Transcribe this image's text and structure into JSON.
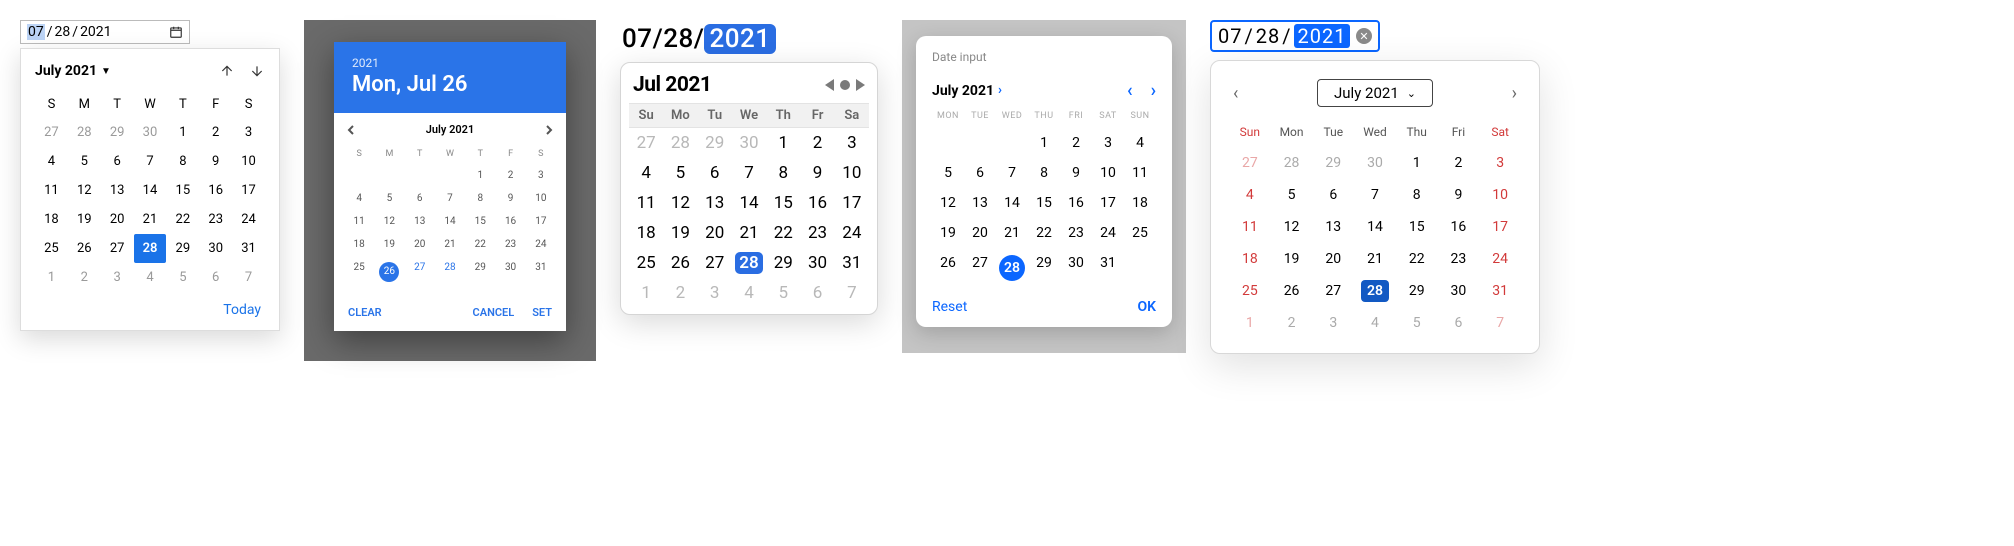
{
  "picker1": {
    "input": {
      "month": "07",
      "day": "28",
      "year": "2021",
      "sep": "/"
    },
    "title": "July 2021",
    "today_label": "Today",
    "dow": [
      "S",
      "M",
      "T",
      "W",
      "T",
      "F",
      "S"
    ],
    "days": [
      {
        "n": 27,
        "muted": true
      },
      {
        "n": 28,
        "muted": true
      },
      {
        "n": 29,
        "muted": true
      },
      {
        "n": 30,
        "muted": true
      },
      {
        "n": 1
      },
      {
        "n": 2
      },
      {
        "n": 3
      },
      {
        "n": 4
      },
      {
        "n": 5
      },
      {
        "n": 6
      },
      {
        "n": 7
      },
      {
        "n": 8
      },
      {
        "n": 9
      },
      {
        "n": 10
      },
      {
        "n": 11
      },
      {
        "n": 12
      },
      {
        "n": 13
      },
      {
        "n": 14
      },
      {
        "n": 15
      },
      {
        "n": 16
      },
      {
        "n": 17
      },
      {
        "n": 18
      },
      {
        "n": 19
      },
      {
        "n": 20
      },
      {
        "n": 21
      },
      {
        "n": 22
      },
      {
        "n": 23
      },
      {
        "n": 24
      },
      {
        "n": 25
      },
      {
        "n": 26
      },
      {
        "n": 27
      },
      {
        "n": 28,
        "sel": true
      },
      {
        "n": 29
      },
      {
        "n": 30
      },
      {
        "n": 31
      },
      {
        "n": 1,
        "muted": true
      },
      {
        "n": 2,
        "muted": true
      },
      {
        "n": 3,
        "muted": true
      },
      {
        "n": 4,
        "muted": true
      },
      {
        "n": 5,
        "muted": true
      },
      {
        "n": 6,
        "muted": true
      },
      {
        "n": 7,
        "muted": true
      }
    ]
  },
  "picker2": {
    "header_year": "2021",
    "header_date": "Mon, Jul 26",
    "nav_title": "July 2021",
    "actions": {
      "clear": "CLEAR",
      "cancel": "CANCEL",
      "set": "SET"
    },
    "dow": [
      "S",
      "M",
      "T",
      "W",
      "T",
      "F",
      "S"
    ],
    "days": [
      {
        "n": ""
      },
      {
        "n": ""
      },
      {
        "n": ""
      },
      {
        "n": ""
      },
      {
        "n": 1
      },
      {
        "n": 2
      },
      {
        "n": 3
      },
      {
        "n": 4
      },
      {
        "n": 5
      },
      {
        "n": 6
      },
      {
        "n": 7
      },
      {
        "n": 8
      },
      {
        "n": 9
      },
      {
        "n": 10
      },
      {
        "n": 11
      },
      {
        "n": 12
      },
      {
        "n": 13
      },
      {
        "n": 14
      },
      {
        "n": 15
      },
      {
        "n": 16
      },
      {
        "n": 17
      },
      {
        "n": 18
      },
      {
        "n": 19
      },
      {
        "n": 20
      },
      {
        "n": 21
      },
      {
        "n": 22
      },
      {
        "n": 23
      },
      {
        "n": 24
      },
      {
        "n": 25
      },
      {
        "n": 26,
        "sel": true
      },
      {
        "n": 27,
        "blue": true
      },
      {
        "n": 28,
        "blue": true
      },
      {
        "n": 29
      },
      {
        "n": 30
      },
      {
        "n": 31
      }
    ]
  },
  "picker3": {
    "input": {
      "month": "07",
      "day": "28",
      "year": "2021",
      "sep": "/"
    },
    "title": "Jul 2021",
    "dow": [
      "Su",
      "Mo",
      "Tu",
      "We",
      "Th",
      "Fr",
      "Sa"
    ],
    "days": [
      {
        "n": 27,
        "muted": true
      },
      {
        "n": 28,
        "muted": true
      },
      {
        "n": 29,
        "muted": true
      },
      {
        "n": 30,
        "muted": true
      },
      {
        "n": 1
      },
      {
        "n": 2
      },
      {
        "n": 3
      },
      {
        "n": 4
      },
      {
        "n": 5
      },
      {
        "n": 6
      },
      {
        "n": 7
      },
      {
        "n": 8
      },
      {
        "n": 9
      },
      {
        "n": 10
      },
      {
        "n": 11
      },
      {
        "n": 12
      },
      {
        "n": 13
      },
      {
        "n": 14
      },
      {
        "n": 15
      },
      {
        "n": 16
      },
      {
        "n": 17
      },
      {
        "n": 18
      },
      {
        "n": 19
      },
      {
        "n": 20
      },
      {
        "n": 21
      },
      {
        "n": 22
      },
      {
        "n": 23
      },
      {
        "n": 24
      },
      {
        "n": 25
      },
      {
        "n": 26
      },
      {
        "n": 27
      },
      {
        "n": 28,
        "sel": true
      },
      {
        "n": 29
      },
      {
        "n": 30
      },
      {
        "n": 31
      },
      {
        "n": 1,
        "muted": true
      },
      {
        "n": 2,
        "muted": true
      },
      {
        "n": 3,
        "muted": true
      },
      {
        "n": 4,
        "muted": true
      },
      {
        "n": 5,
        "muted": true
      },
      {
        "n": 6,
        "muted": true
      },
      {
        "n": 7,
        "muted": true
      }
    ]
  },
  "picker4": {
    "label": "Date input",
    "title": "July 2021",
    "actions": {
      "reset": "Reset",
      "ok": "OK"
    },
    "dow": [
      "MON",
      "TUE",
      "WED",
      "THU",
      "FRI",
      "SAT",
      "SUN"
    ],
    "days": [
      {
        "n": ""
      },
      {
        "n": ""
      },
      {
        "n": ""
      },
      {
        "n": 1
      },
      {
        "n": 2
      },
      {
        "n": 3
      },
      {
        "n": 4
      },
      {
        "n": 5
      },
      {
        "n": 6
      },
      {
        "n": 7
      },
      {
        "n": 8
      },
      {
        "n": 9
      },
      {
        "n": 10
      },
      {
        "n": 11
      },
      {
        "n": 12
      },
      {
        "n": 13
      },
      {
        "n": 14
      },
      {
        "n": 15
      },
      {
        "n": 16
      },
      {
        "n": 17
      },
      {
        "n": 18
      },
      {
        "n": 19
      },
      {
        "n": 20
      },
      {
        "n": 21
      },
      {
        "n": 22
      },
      {
        "n": 23
      },
      {
        "n": 24
      },
      {
        "n": 25
      },
      {
        "n": 26
      },
      {
        "n": 27
      },
      {
        "n": 28,
        "sel": true
      },
      {
        "n": 29
      },
      {
        "n": 30
      },
      {
        "n": 31
      },
      {
        "n": ""
      }
    ]
  },
  "picker5": {
    "input": {
      "month": "07",
      "day": "28",
      "year": "2021",
      "sep": " / "
    },
    "month_label": "July 2021",
    "dow": [
      {
        "t": "Sun",
        "w": true
      },
      {
        "t": "Mon"
      },
      {
        "t": "Tue"
      },
      {
        "t": "Wed"
      },
      {
        "t": "Thu"
      },
      {
        "t": "Fri"
      },
      {
        "t": "Sat",
        "w": true
      }
    ],
    "days": [
      {
        "n": 27,
        "cls": "redm"
      },
      {
        "n": 28,
        "cls": "muted"
      },
      {
        "n": 29,
        "cls": "muted"
      },
      {
        "n": 30,
        "cls": "muted"
      },
      {
        "n": 1
      },
      {
        "n": 2
      },
      {
        "n": 3,
        "cls": "red"
      },
      {
        "n": 4,
        "cls": "red"
      },
      {
        "n": 5
      },
      {
        "n": 6
      },
      {
        "n": 7
      },
      {
        "n": 8
      },
      {
        "n": 9
      },
      {
        "n": 10,
        "cls": "red"
      },
      {
        "n": 11,
        "cls": "red"
      },
      {
        "n": 12
      },
      {
        "n": 13
      },
      {
        "n": 14
      },
      {
        "n": 15
      },
      {
        "n": 16
      },
      {
        "n": 17,
        "cls": "red"
      },
      {
        "n": 18,
        "cls": "red"
      },
      {
        "n": 19
      },
      {
        "n": 20
      },
      {
        "n": 21
      },
      {
        "n": 22
      },
      {
        "n": 23
      },
      {
        "n": 24,
        "cls": "red"
      },
      {
        "n": 25,
        "cls": "red"
      },
      {
        "n": 26
      },
      {
        "n": 27
      },
      {
        "n": 28,
        "sel": true
      },
      {
        "n": 29
      },
      {
        "n": 30
      },
      {
        "n": 31,
        "cls": "red"
      },
      {
        "n": 1,
        "cls": "redm"
      },
      {
        "n": 2,
        "cls": "muted"
      },
      {
        "n": 3,
        "cls": "muted"
      },
      {
        "n": 4,
        "cls": "muted"
      },
      {
        "n": 5,
        "cls": "muted"
      },
      {
        "n": 6,
        "cls": "muted"
      },
      {
        "n": 7,
        "cls": "redm"
      }
    ]
  }
}
